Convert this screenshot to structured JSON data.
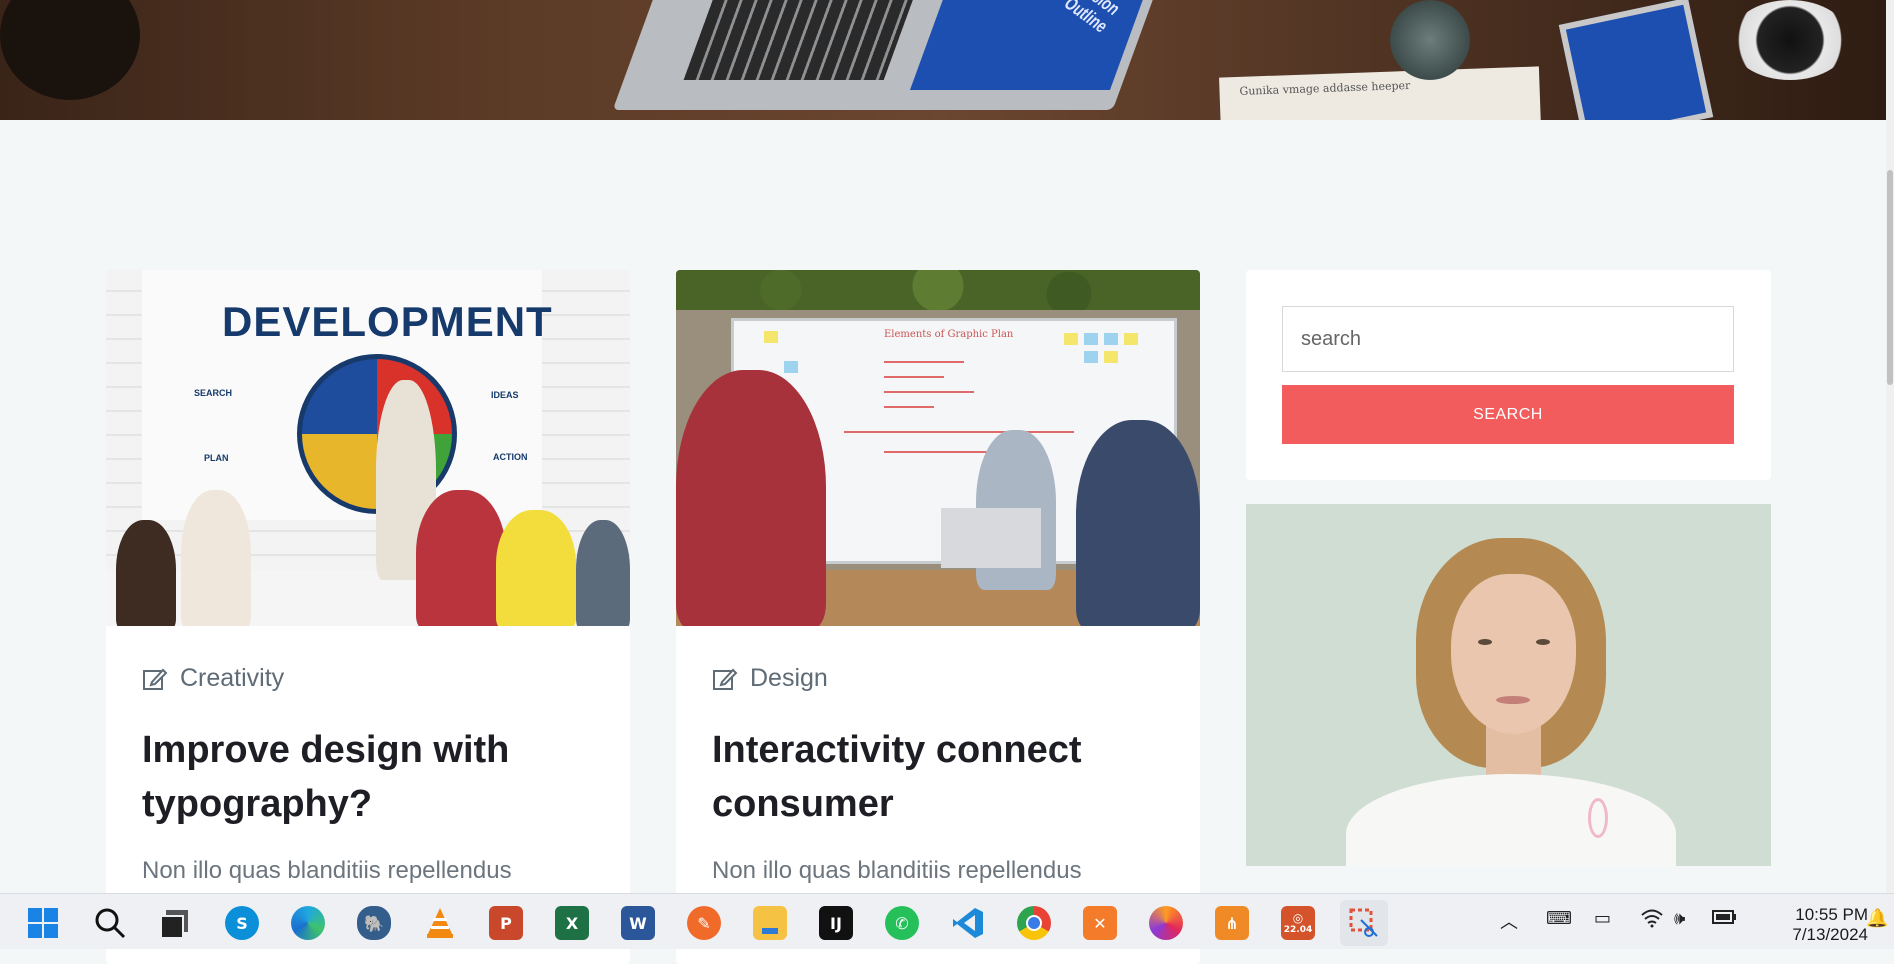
{
  "hero": {
    "screen_text": "ussion\nOutline",
    "tablet_text": "ussion\nOutline",
    "notebook_text": "Gunika vmage  addasse  heeper"
  },
  "cards": [
    {
      "image": {
        "board_title": "DEVELOPMENT",
        "labels": [
          "SEARCH",
          "IDEAS",
          "PLAN",
          "ACTION"
        ]
      },
      "category": "Creativity",
      "category_icon": "edit-icon",
      "title": "Improve design with typography?",
      "excerpt": "Non illo quas blanditiis repellendus"
    },
    {
      "image": {
        "board_title": "Elements of Graphic Plan"
      },
      "category": "Design",
      "category_icon": "edit-icon",
      "title": "Interactivity connect consumer",
      "excerpt": "Non illo quas blanditiis repellendus"
    }
  ],
  "sidebar": {
    "search": {
      "placeholder": "search",
      "button_label": "SEARCH",
      "button_color": "#f25c5c"
    }
  },
  "taskbar": {
    "apps": [
      "windows-start",
      "search",
      "task-view",
      "skype",
      "edge",
      "postgresql",
      "vlc",
      "powerpoint",
      "excel",
      "word",
      "pen-app",
      "file-explorer",
      "intellij",
      "whatsapp",
      "vscode",
      "chrome",
      "xampp",
      "firefox",
      "git-gui",
      "ubuntu",
      "snipping-tool"
    ],
    "ubuntu_badge": "22.04",
    "time": "10:55 PM",
    "date": "7/13/2024"
  }
}
